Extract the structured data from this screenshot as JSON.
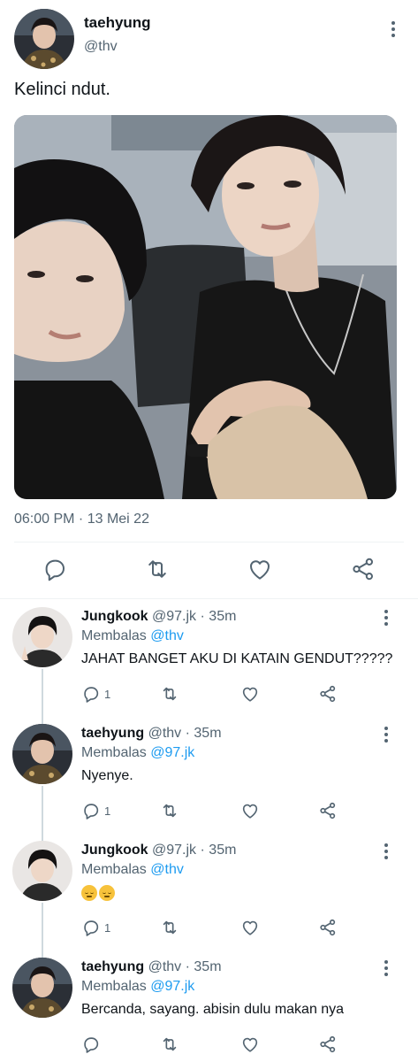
{
  "main_tweet": {
    "name": "taehyung",
    "handle": "@thv",
    "text": "Kelinci ndut.",
    "timestamp": "06:00 PM · 13 Mei 22",
    "avatar_icon": "avatar-taehyung"
  },
  "replies": [
    {
      "name": "Jungkook",
      "handle": "@97.jk",
      "time": "· 35m",
      "replying_label": "Membalas",
      "replying_to": "@thv",
      "text": "JAHAT BANGET AKU DI KATAIN GENDUT?????",
      "reply_count": "1"
    },
    {
      "name": "taehyung",
      "handle": "@thv",
      "time": "· 35m",
      "replying_label": "Membalas",
      "replying_to": "@97.jk",
      "text": "Nyenye.",
      "reply_count": "1"
    },
    {
      "name": "Jungkook",
      "handle": "@97.jk",
      "time": "· 35m",
      "replying_label": "Membalas",
      "replying_to": "@thv",
      "text": "",
      "emoji": [
        "pensive-face-icon",
        "pensive-face-icon"
      ],
      "reply_count": "1"
    },
    {
      "name": "taehyung",
      "handle": "@thv",
      "time": "· 35m",
      "replying_label": "Membalas",
      "replying_to": "@97.jk",
      "text": "Bercanda, sayang. abisin dulu makan nya",
      "reply_count": ""
    }
  ],
  "colors": {
    "text": "#0f1419",
    "secondary": "#536471",
    "link": "#1d9bf0",
    "divider": "#eff3f4"
  },
  "icons": [
    "more-icon",
    "reply-icon",
    "retweet-icon",
    "like-icon",
    "share-icon"
  ]
}
